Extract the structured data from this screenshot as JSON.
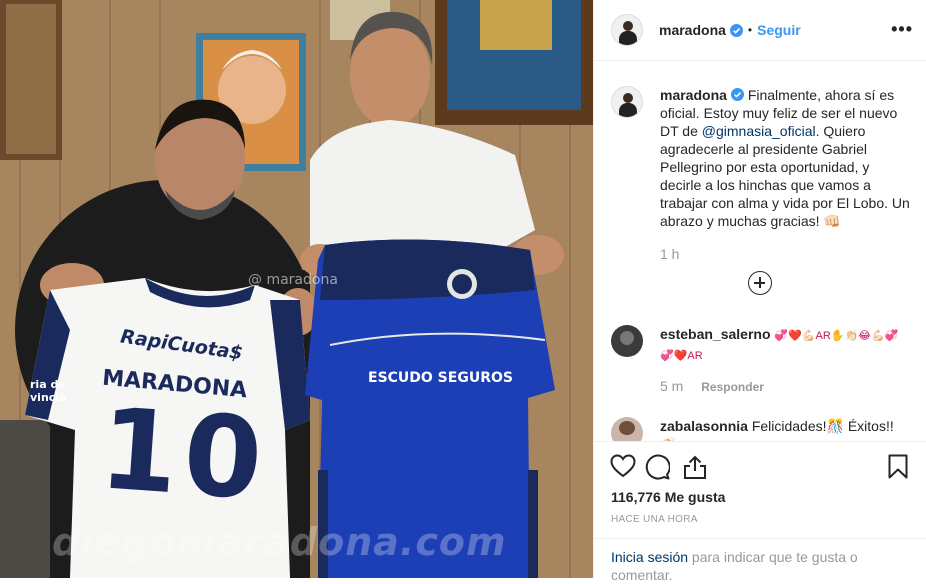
{
  "photo": {
    "watermark": "diegomaradona.com",
    "ig_mark": "@ maradona",
    "jersey_left_sponsor": "RapiCuota$",
    "jersey_left_name": "MARADONA",
    "jersey_left_number": "10",
    "jersey_left_sleeve": "ria de vincia",
    "jersey_right_sponsor": "ESCUDO SEGUROS",
    "colors": {
      "wall": "#a4825c",
      "jersey_blue": "#1a40b8",
      "jersey_navy": "#1b2a5c",
      "shirt_white": "#f4f4f2"
    }
  },
  "header": {
    "username": "maradona",
    "separator": "•",
    "follow_label": "Seguir",
    "more_label": "•••"
  },
  "caption": {
    "username": "maradona",
    "text_part1": "Finalmente, ahora sí es oficial. Estoy muy feliz de ser el nuevo DT de",
    "mention": "@gimnasia_oficial",
    "text_part2": ". Quiero agradecerle al presidente Gabriel Pellegrino por esta oportunidad, y decirle a los hinchas que vamos a trabajar con alma y vida por El Lobo. Un abrazo y muchas gracias! 👊🏻",
    "time": "1 h"
  },
  "comments": [
    {
      "username": "esteban_salerno",
      "text": "💞❤️💪🏻AR✋👏🏻😂💪🏻💞 💞❤️AR",
      "time": "5 m",
      "reply_label": "Responder"
    },
    {
      "username": "zabalasonnia",
      "text": "Felicidades!🎊 Éxitos!! 👏🏻",
      "time": "",
      "reply_label": ""
    }
  ],
  "actions": {
    "icons": [
      "heart-icon",
      "comment-icon",
      "share-icon",
      "bookmark-icon"
    ],
    "likes": "116,776 Me gusta",
    "posted_ago": "HACE UNA HORA",
    "login_link": "Inicia sesión",
    "login_rest": " para indicar que te gusta o comentar."
  },
  "colors": {
    "link": "#3897f0",
    "mention": "#003569",
    "muted": "#999999",
    "text": "#262626",
    "verified": "#3897f0"
  }
}
